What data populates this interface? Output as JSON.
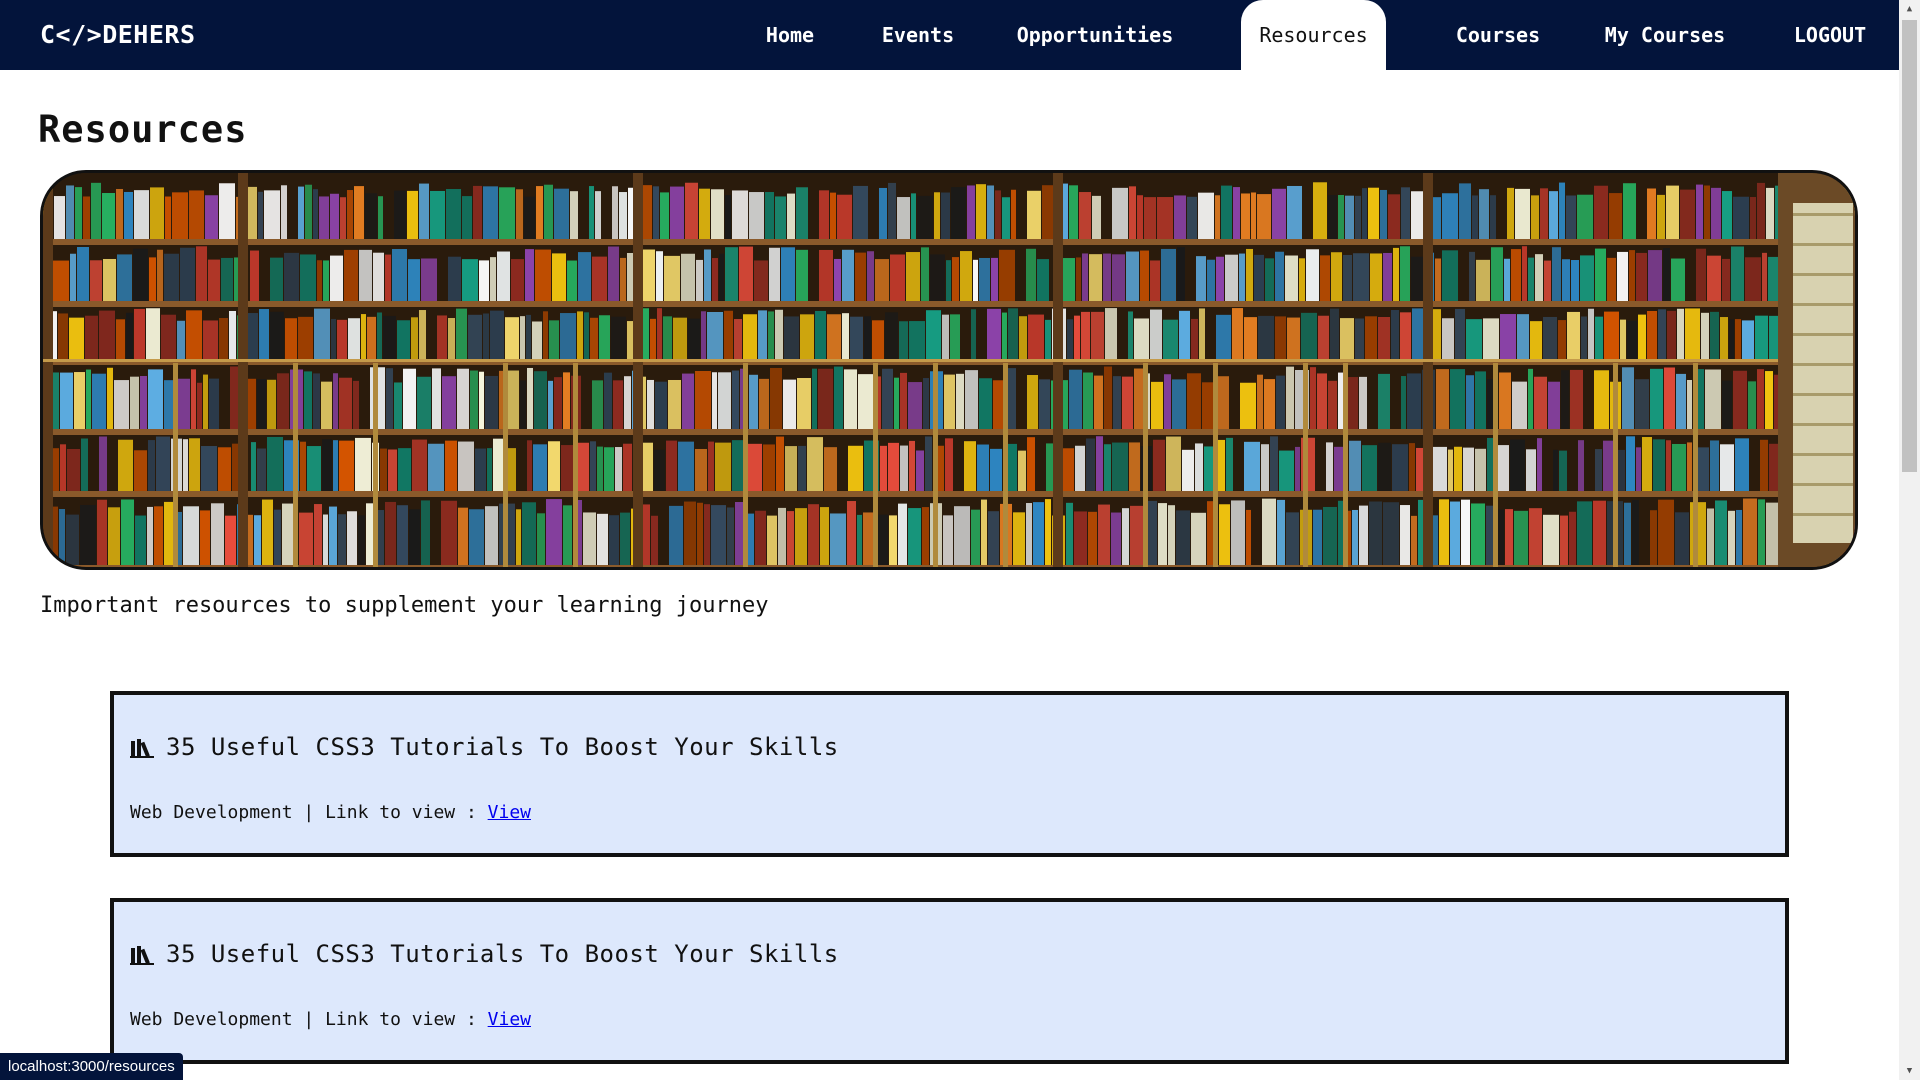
{
  "nav": {
    "logo": "C</>DEHERS",
    "items": [
      {
        "label": "Home",
        "active": false
      },
      {
        "label": "Events",
        "active": false
      },
      {
        "label": "Opportunities",
        "active": false
      },
      {
        "label": "Resources",
        "active": true
      },
      {
        "label": "Courses",
        "active": false
      },
      {
        "label": "My Courses",
        "active": false
      },
      {
        "label": "LOGOUT",
        "active": false
      }
    ]
  },
  "page": {
    "title": "Resources",
    "subtitle": "Important resources to supplement your learning journey"
  },
  "resources": [
    {
      "icon": "books-icon",
      "title": "35 Useful CSS3 Tutorials To Boost Your Skills",
      "category": "Web Development",
      "separator": " | Link to view : ",
      "link_label": "View"
    },
    {
      "icon": "books-icon",
      "title": "35 Useful CSS3 Tutorials To Boost Your Skills",
      "category": "Web Development",
      "separator": " | Link to view : ",
      "link_label": "View"
    }
  ],
  "status_bar": {
    "url": "localhost:3000/resources"
  },
  "colors": {
    "nav_bg": "#03143b",
    "card_bg": "#dde8fc",
    "link": "#0000ee"
  }
}
